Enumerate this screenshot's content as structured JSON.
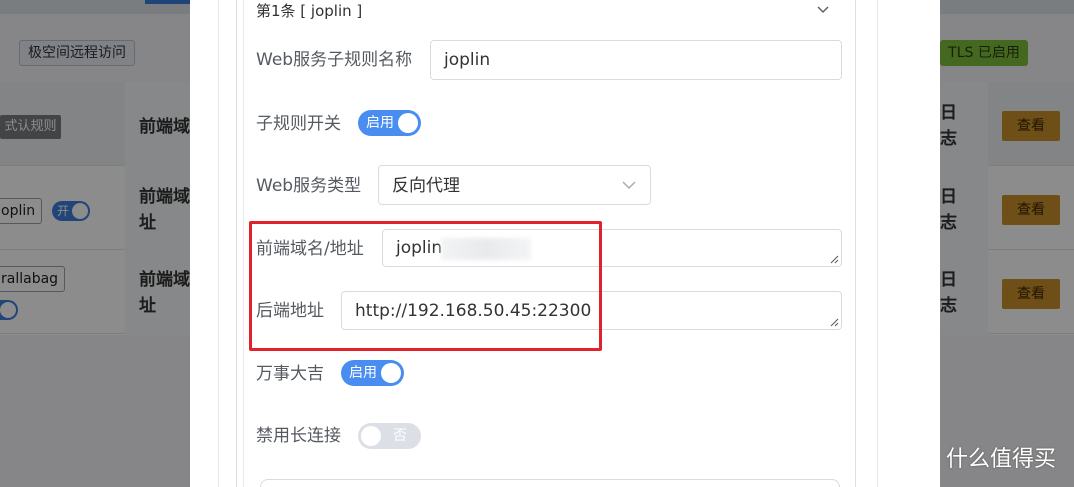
{
  "background": {
    "remote_access_label": "极空间远程访问",
    "tls_label": "TLS 已启用",
    "default_rule_label": "式认规则",
    "col_frontend_header": "前端域",
    "col_frontend_row": "前端域\n址",
    "col_log_header": "日\n志",
    "rows": [
      {
        "tag": "oplin",
        "switch_label": "开"
      },
      {
        "tag": "rallabag",
        "switch_label": ""
      }
    ],
    "view_button_label": "查看"
  },
  "modal": {
    "card_title": "第1条 [ joplin ]",
    "fields": {
      "subrule_name_label": "Web服务子规则名称",
      "subrule_name_value": "joplin",
      "subrule_switch_label": "子规则开关",
      "subrule_switch_text": "启用",
      "service_type_label": "Web服务类型",
      "service_type_value": "反向代理",
      "frontend_label": "前端域名/地址",
      "frontend_value": "joplin",
      "backend_label": "后端地址",
      "backend_value": "http://192.168.50.45:22300",
      "wanshi_label": "万事大吉",
      "wanshi_switch_text": "启用",
      "keepalive_label": "禁用长连接",
      "keepalive_switch_text": "否"
    }
  },
  "watermark": {
    "text": "什么值得买"
  },
  "colors": {
    "switch_on": "#4a8df1",
    "highlight_box": "#e0222c",
    "view_button": "#c9912a",
    "tls_badge": "#7cbd3b"
  }
}
